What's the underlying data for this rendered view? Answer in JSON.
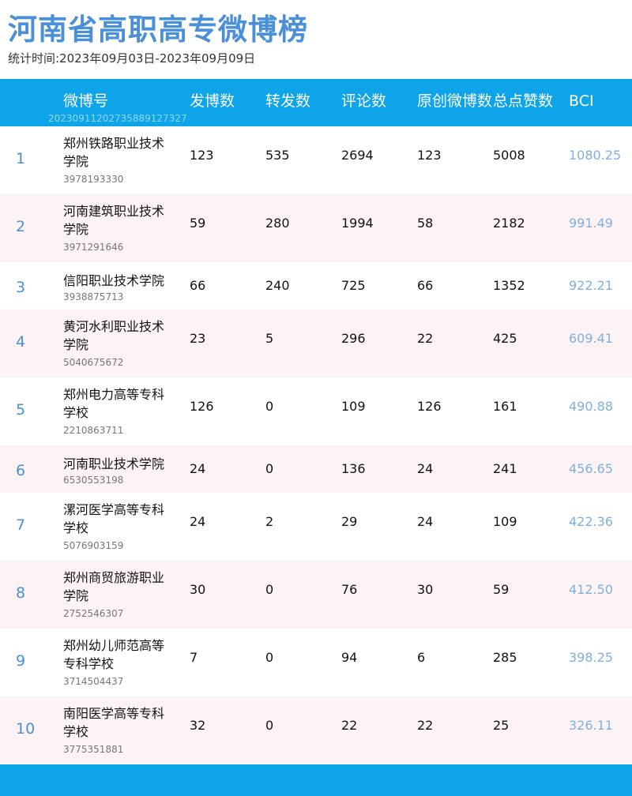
{
  "title": "河南省高职高专微博榜",
  "subtitle": "统计时间:2023年09月03日-2023年09月09日",
  "header": {
    "col_name": "微博号",
    "col_posts": "发博数",
    "col_reposts": "转发数",
    "col_comments": "评论数",
    "col_original": "原创微博数",
    "col_likes": "总点赞数",
    "col_bci": "BCI",
    "watermark": "20230911202735889127327"
  },
  "rows": [
    {
      "rank": "1",
      "name": "郑州铁路职业技术学院",
      "uid": "3978193330",
      "posts": "123",
      "reposts": "535",
      "comments": "2694",
      "original": "123",
      "likes": "5008",
      "bci": "1080.25"
    },
    {
      "rank": "2",
      "name": "河南建筑职业技术学院",
      "uid": "3971291646",
      "posts": "59",
      "reposts": "280",
      "comments": "1994",
      "original": "58",
      "likes": "2182",
      "bci": "991.49"
    },
    {
      "rank": "3",
      "name": "信阳职业技术学院",
      "uid": "3938875713",
      "posts": "66",
      "reposts": "240",
      "comments": "725",
      "original": "66",
      "likes": "1352",
      "bci": "922.21"
    },
    {
      "rank": "4",
      "name": "黄河水利职业技术学院",
      "uid": "5040675672",
      "posts": "23",
      "reposts": "5",
      "comments": "296",
      "original": "22",
      "likes": "425",
      "bci": "609.41"
    },
    {
      "rank": "5",
      "name": "郑州电力高等专科学校",
      "uid": "2210863711",
      "posts": "126",
      "reposts": "0",
      "comments": "109",
      "original": "126",
      "likes": "161",
      "bci": "490.88"
    },
    {
      "rank": "6",
      "name": "河南职业技术学院",
      "uid": "6530553198",
      "posts": "24",
      "reposts": "0",
      "comments": "136",
      "original": "24",
      "likes": "241",
      "bci": "456.65"
    },
    {
      "rank": "7",
      "name": "漯河医学高等专科学校",
      "uid": "5076903159",
      "posts": "24",
      "reposts": "2",
      "comments": "29",
      "original": "24",
      "likes": "109",
      "bci": "422.36"
    },
    {
      "rank": "8",
      "name": "郑州商贸旅游职业学院",
      "uid": "2752546307",
      "posts": "30",
      "reposts": "0",
      "comments": "76",
      "original": "30",
      "likes": "59",
      "bci": "412.50"
    },
    {
      "rank": "9",
      "name": "郑州幼儿师范高等专科学校",
      "uid": "3714504437",
      "posts": "7",
      "reposts": "0",
      "comments": "94",
      "original": "6",
      "likes": "285",
      "bci": "398.25"
    },
    {
      "rank": "10",
      "name": "南阳医学高等专科学校",
      "uid": "3775351881",
      "posts": "32",
      "reposts": "0",
      "comments": "22",
      "original": "22",
      "likes": "25",
      "bci": "326.11"
    }
  ]
}
